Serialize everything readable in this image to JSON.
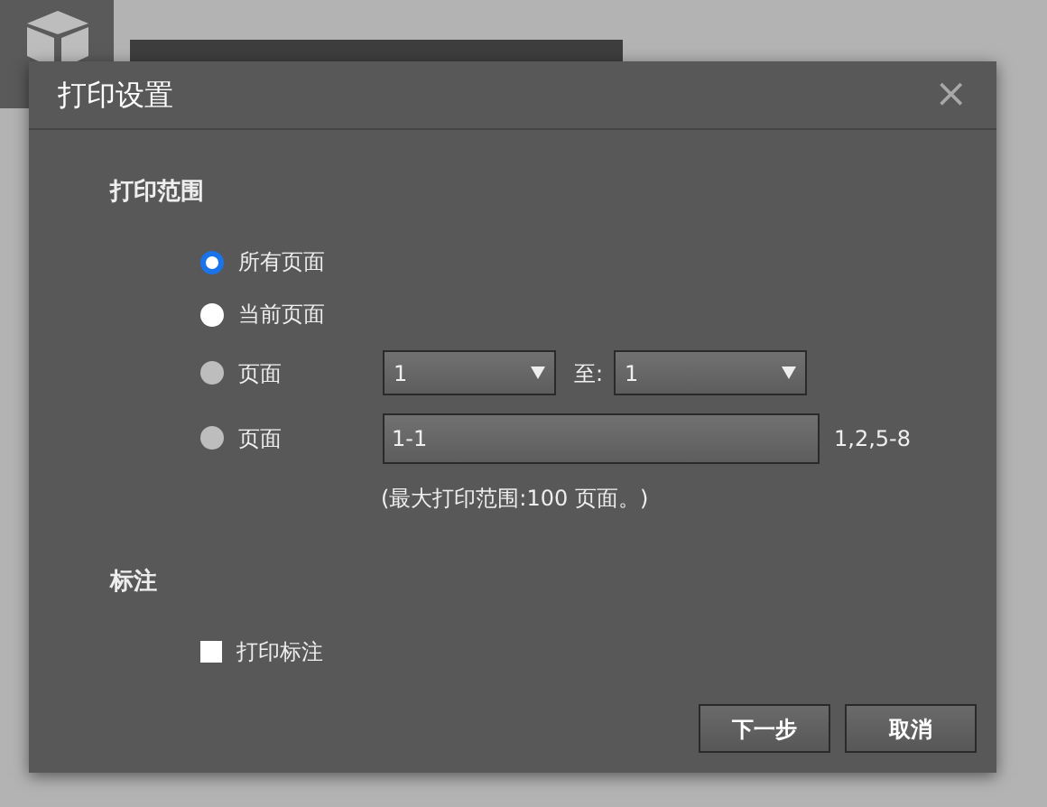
{
  "dialog": {
    "title": "打印设置",
    "close": "×"
  },
  "print_range": {
    "heading": "打印范围",
    "options": [
      {
        "kind": "plain",
        "label": "所有页面",
        "selected": true,
        "disabled": false
      },
      {
        "kind": "plain",
        "label": "当前页面",
        "selected": false,
        "disabled": false
      },
      {
        "kind": "range",
        "label": "页面",
        "selected": false,
        "disabled": true,
        "from": "1",
        "to_label": "至:",
        "to": "1"
      },
      {
        "kind": "list",
        "label": "页面",
        "selected": false,
        "disabled": true,
        "value": "1-1",
        "hint": "1,2,5-8"
      }
    ],
    "note": "(最大打印范围:100 页面。)"
  },
  "annotations": {
    "heading": "标注",
    "checkbox": {
      "label": "打印标注",
      "checked": false
    }
  },
  "buttons": [
    {
      "label": "下一步"
    },
    {
      "label": "取消"
    }
  ]
}
